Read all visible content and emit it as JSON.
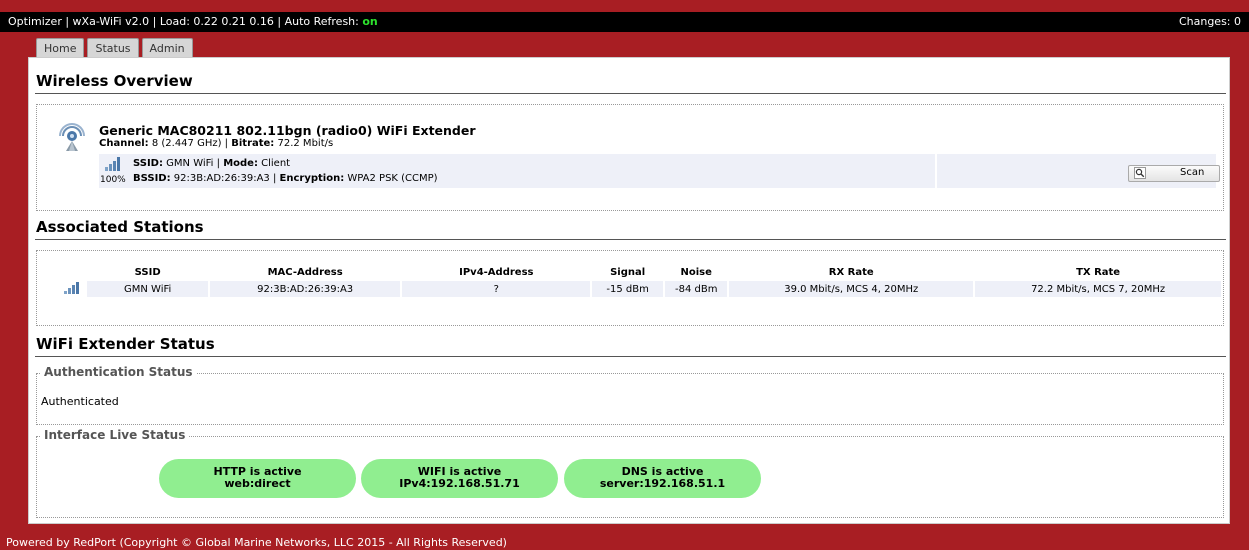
{
  "topbar": {
    "prefix": "Optimizer | wXa-WiFi v2.0 | Load: 0.22 0.21 0.16 | Auto Refresh: ",
    "auto_refresh": "on",
    "changes": "Changes: 0"
  },
  "tabs": [
    "Home",
    "Status",
    "Admin"
  ],
  "wireless": {
    "heading": "Wireless Overview",
    "device_title": "Generic MAC80211 802.11bgn (radio0) WiFi Extender",
    "channel_label": "Channel:",
    "channel_value": " 8 (2.447 GHz) | ",
    "bitrate_label": "Bitrate:",
    "bitrate_value": " 72.2 Mbit/s",
    "signal_percent": "100%",
    "ssid_label": "SSID:",
    "ssid_value": " GMN WiFi | ",
    "mode_label": "Mode:",
    "mode_value": " Client",
    "bssid_label": "BSSID:",
    "bssid_value": " 92:3B:AD:26:39:A3 | ",
    "encryption_label": "Encryption:",
    "encryption_value": " WPA2 PSK (CCMP)",
    "scan_label": "Scan"
  },
  "stations": {
    "heading": "Associated Stations",
    "columns": [
      "SSID",
      "MAC-Address",
      "IPv4-Address",
      "Signal",
      "Noise",
      "RX Rate",
      "TX Rate"
    ],
    "rows": [
      [
        "GMN WiFi",
        "92:3B:AD:26:39:A3",
        "?",
        "-15 dBm",
        "-84 dBm",
        "39.0 Mbit/s, MCS 4, 20MHz",
        "72.2 Mbit/s, MCS 7, 20MHz"
      ]
    ]
  },
  "extender": {
    "heading": "WiFi Extender Status",
    "auth_legend": "Authentication Status",
    "auth_value": "Authenticated",
    "iface_legend": "Interface Live Status",
    "pills": [
      {
        "line1": "HTTP is active",
        "line2": "web:direct"
      },
      {
        "line1": "WIFI is active",
        "line2": "IPv4:192.168.51.71"
      },
      {
        "line1": "DNS is active",
        "line2": "server:192.168.51.1"
      }
    ]
  },
  "footer": "Powered by RedPort (Copyright © Global Marine Networks, LLC 2015 - All Rights Reserved)",
  "colors": {
    "background": "#a81e23",
    "topbar": "#000000",
    "status_on": "#2de12d",
    "pill": "#90ee90",
    "row_bg": "#eef0f8"
  },
  "icons": [
    "radio-antenna-icon",
    "signal-strength-icon",
    "magnifier-icon"
  ]
}
